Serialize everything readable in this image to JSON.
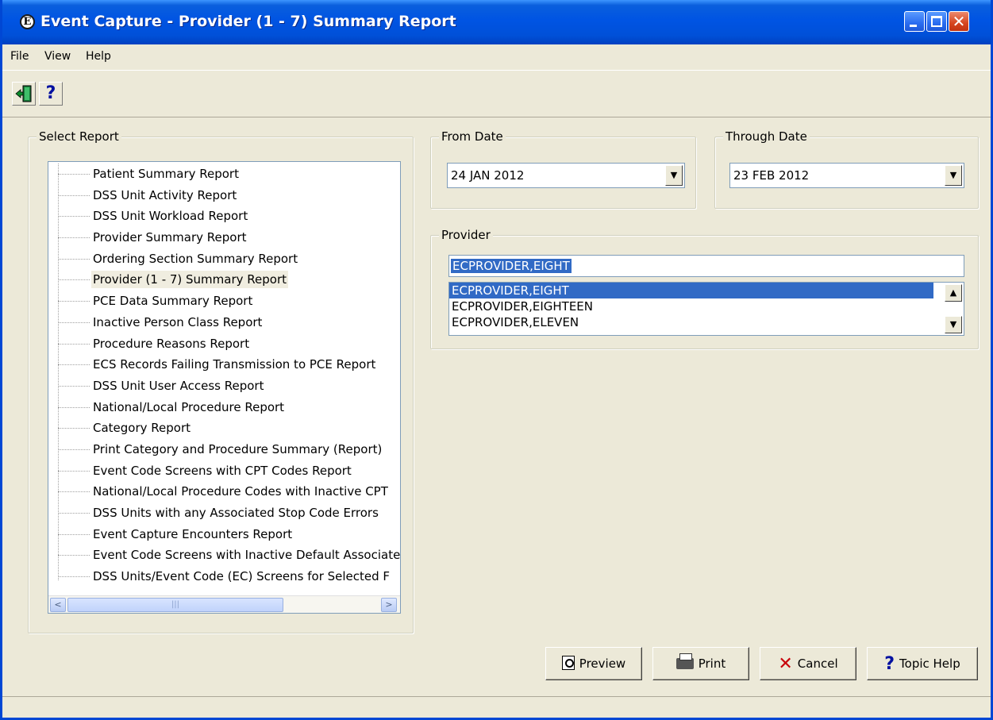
{
  "window": {
    "title": "Event Capture - Provider (1 - 7) Summary Report",
    "app_icon_letter": "E",
    "controls": {
      "minimize": "minimize",
      "maximize": "maximize",
      "close": "✕"
    }
  },
  "menu": {
    "items": [
      "File",
      "View",
      "Help"
    ]
  },
  "toolbar": {
    "exit_icon": "exit-door-icon",
    "help_label": "?"
  },
  "select_report": {
    "label": "Select Report",
    "items": [
      "Patient Summary Report",
      "DSS Unit Activity Report",
      "DSS Unit Workload Report",
      "Provider Summary Report",
      "Ordering Section Summary Report",
      "Provider (1 - 7) Summary Report",
      "PCE Data Summary Report",
      "Inactive Person Class Report",
      "Procedure Reasons Report",
      "ECS Records Failing Transmission to PCE Report",
      "DSS Unit User Access Report",
      "National/Local Procedure Report",
      "Category Report",
      "Print Category and Procedure Summary (Report)",
      "Event Code Screens with CPT Codes Report",
      "National/Local Procedure Codes with Inactive CPT",
      "DSS Units with any Associated Stop Code Errors",
      "Event Capture Encounters Report",
      "Event Code Screens with Inactive Default Associate",
      "DSS Units/Event Code (EC) Screens for Selected F"
    ],
    "selected_index": 5,
    "scrollbar": {
      "left_arrow": "<",
      "right_arrow": ">",
      "thumb_grip": "|||"
    }
  },
  "from_date": {
    "label": "From Date",
    "value": "24 JAN 2012",
    "drop_arrow": "▼"
  },
  "through_date": {
    "label": "Through Date",
    "value": "23 FEB 2012",
    "drop_arrow": "▼"
  },
  "provider": {
    "label": "Provider",
    "input_value": "ECPROVIDER,EIGHT",
    "options": [
      "ECPROVIDER,EIGHT",
      "ECPROVIDER,EIGHTEEN",
      "ECPROVIDER,ELEVEN"
    ],
    "selected_index": 0,
    "scroll_up": "▲",
    "scroll_down": "▼"
  },
  "buttons": {
    "preview": "Preview",
    "print": "Print",
    "cancel": "Cancel",
    "topic_help": "Topic Help",
    "cancel_icon": "✕",
    "help_icon": "?"
  },
  "colors": {
    "titlebar": "#0054e3",
    "window_bg": "#ece9d8",
    "selection": "#316ac5"
  }
}
